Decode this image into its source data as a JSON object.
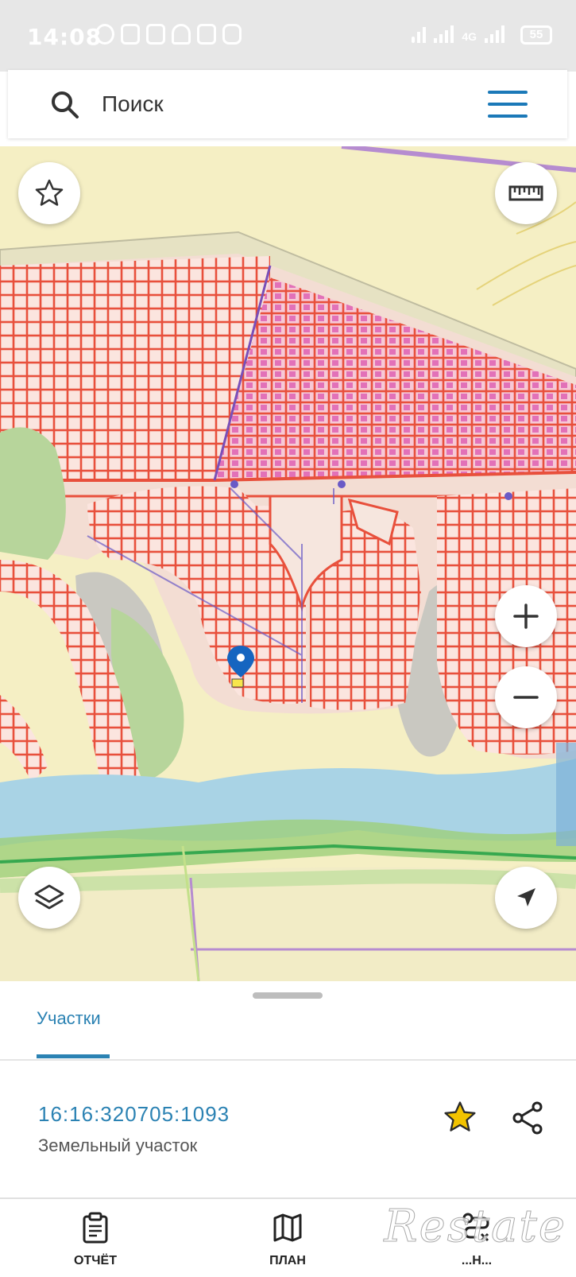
{
  "status_bar": {
    "time": "14:08",
    "network_label": "4G",
    "battery": "55"
  },
  "search": {
    "placeholder": "Поиск"
  },
  "tabs": {
    "active_label": "Участки"
  },
  "parcel": {
    "cadastral_number": "16:16:320705:1093",
    "type": "Земельный участок"
  },
  "bottom_nav": {
    "report_label": "ОТЧЁТ",
    "plan_label": "ПЛАН",
    "third_label": "...Н..."
  },
  "watermark": {
    "text": "Restate"
  },
  "colors": {
    "accent": "#2b82b3",
    "parcel_red": "#e8503c",
    "map_bg": "#f5efc4",
    "water": "#a9d3e5",
    "forest": "#a8cf8e",
    "marker": "#1565c0",
    "favorite_star": "#f2c300"
  },
  "icons": {
    "favorites": "star-icon",
    "ruler": "ruler-icon",
    "zoom_in": "plus-icon",
    "zoom_out": "minus-icon",
    "layers": "layers-icon",
    "locate": "navigation-arrow-icon",
    "search": "search-icon",
    "menu": "hamburger-menu-icon",
    "share": "share-icon"
  }
}
